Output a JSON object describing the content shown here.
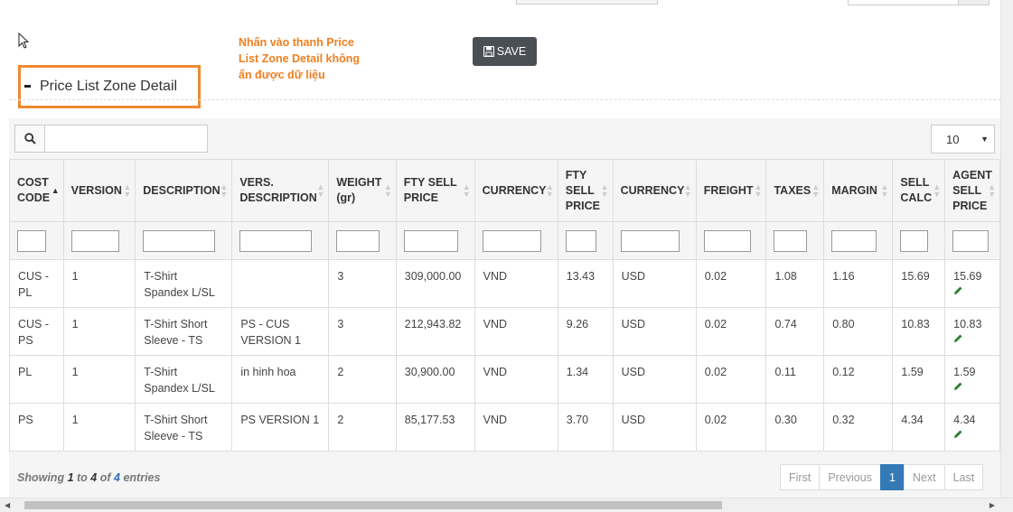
{
  "annotation": {
    "note": "Nhấn vào thanh Price List Zone Detail không ẩn được dữ liệu"
  },
  "toolbar": {
    "save_label": "SAVE"
  },
  "section": {
    "title": "Price List Zone Detail"
  },
  "search": {
    "value": "",
    "placeholder": ""
  },
  "page_size": {
    "selected": "10"
  },
  "table": {
    "columns": [
      {
        "label": "COST CODE",
        "sort": "asc"
      },
      {
        "label": "VERSION",
        "sort": "none"
      },
      {
        "label": "DESCRIPTION",
        "sort": "none"
      },
      {
        "label": "VERS. DESCRIPTION",
        "sort": "none"
      },
      {
        "label": "WEIGHT (gr)",
        "sort": "none"
      },
      {
        "label": "FTY SELL PRICE",
        "sort": "none"
      },
      {
        "label": "CURRENCY",
        "sort": "none"
      },
      {
        "label": "FTY SELL PRICE",
        "sort": "none"
      },
      {
        "label": "CURRENCY",
        "sort": "none"
      },
      {
        "label": "FREIGHT",
        "sort": "none"
      },
      {
        "label": "TAXES",
        "sort": "none"
      },
      {
        "label": "MARGIN",
        "sort": "none"
      },
      {
        "label": "SELL CALC",
        "sort": "none"
      },
      {
        "label": "AGENT SELL PRICE",
        "sort": "none"
      }
    ],
    "rows": [
      [
        "CUS - PL",
        "1",
        "T-Shirt Spandex L/SL",
        "",
        "3",
        "309,000.00",
        "VND",
        "13.43",
        "USD",
        "0.02",
        "1.08",
        "1.16",
        "15.69",
        "15.69"
      ],
      [
        "CUS - PS",
        "1",
        "T-Shirt Short Sleeve - TS",
        "PS - CUS VERSION 1",
        "3",
        "212,943.82",
        "VND",
        "9.26",
        "USD",
        "0.02",
        "0.74",
        "0.80",
        "10.83",
        "10.83"
      ],
      [
        "PL",
        "1",
        "T-Shirt Spandex L/SL",
        "in hinh hoa",
        "2",
        "30,900.00",
        "VND",
        "1.34",
        "USD",
        "0.02",
        "0.11",
        "0.12",
        "1.59",
        "1.59"
      ],
      [
        "PS",
        "1",
        "T-Shirt Short Sleeve - TS",
        "PS VERSION 1",
        "2",
        "85,177.53",
        "VND",
        "3.70",
        "USD",
        "0.02",
        "0.30",
        "0.32",
        "4.34",
        "4.34"
      ]
    ]
  },
  "footer": {
    "entries_word": "Showing",
    "entries_from": "1",
    "entries_to_word": "to",
    "entries_to": "4",
    "entries_of_word": "of",
    "entries_total": "4",
    "entries_suffix": "entries"
  },
  "pagination": {
    "first": "First",
    "previous": "Previous",
    "current": "1",
    "next": "Next",
    "last": "Last"
  },
  "colors": {
    "accent": "#f08a30",
    "save_bg": "#4a4f55",
    "active_page": "#337ab7",
    "edit_icon": "#2e7d32"
  }
}
